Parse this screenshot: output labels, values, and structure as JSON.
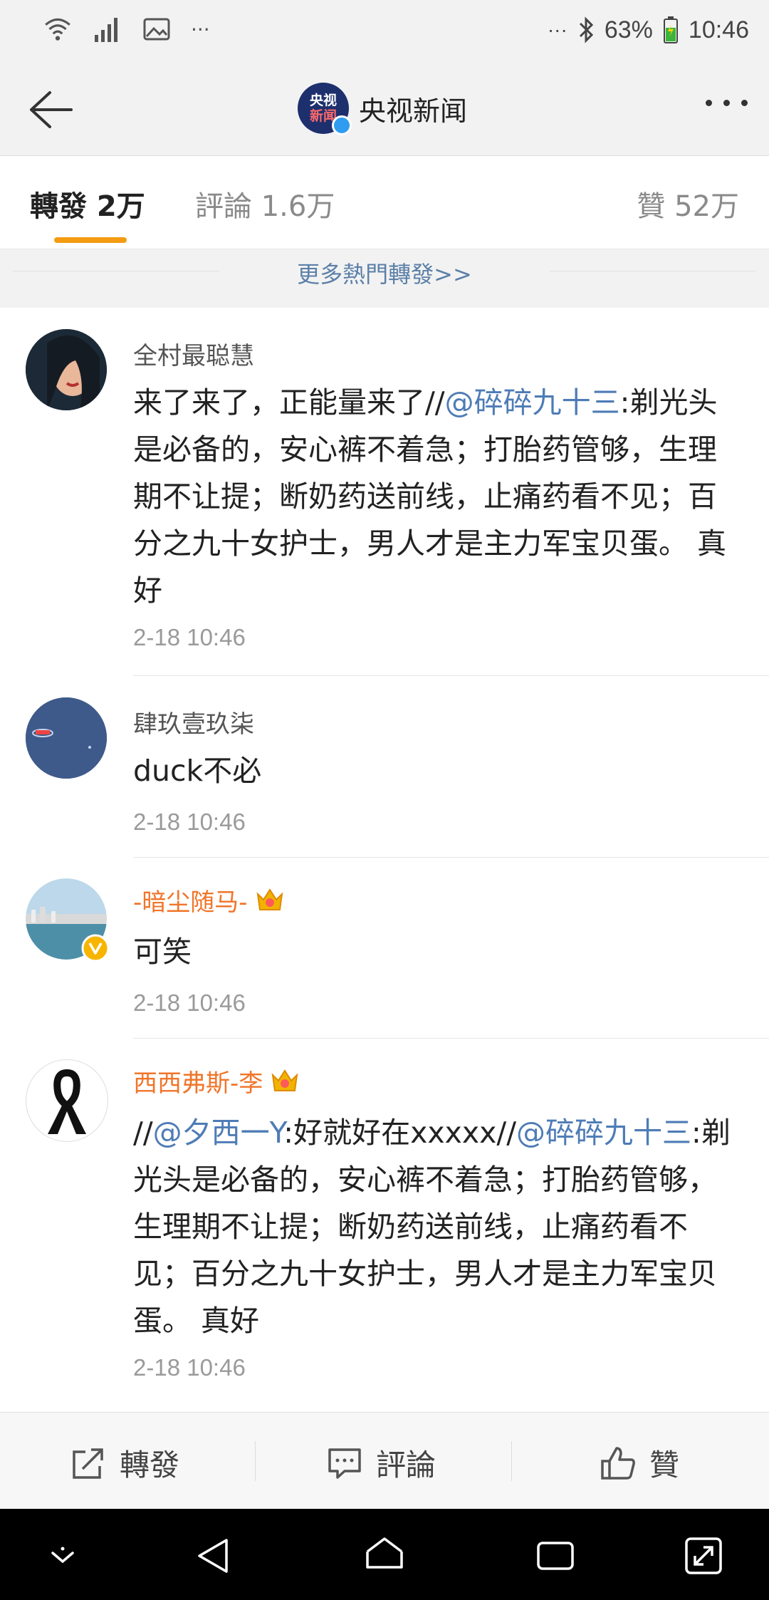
{
  "status_bar": {
    "dots_left": "···",
    "dots_right": "···",
    "battery": "63%",
    "time": "10:46"
  },
  "header": {
    "logo_line1": "央视",
    "logo_line2": "新闻",
    "title": "央视新闻"
  },
  "tabs": {
    "repost": "轉發 2万",
    "comment": "評論 1.6万",
    "like": "贊 52万"
  },
  "more_hot": "更多熱門轉發>>",
  "feed": [
    {
      "name": "全村最聪慧",
      "content_pre": "来了来了，正能量来了//",
      "mention": "@碎碎九十三",
      "content_post": ":剃光头是必备的，安心裤不着急；打胎药管够，生理期不让提；断奶药送前线，止痛药看不见；百分之九十女护士，男人才是主力军宝贝蛋。 真好",
      "time": "2-18 10:46"
    },
    {
      "name": "肆玖壹玖柒",
      "content": "duck不必",
      "time": "2-18 10:46"
    },
    {
      "name": "-暗尘随马-",
      "content": "可笑",
      "time": "2-18 10:46"
    },
    {
      "name": "西西弗斯-李",
      "content_pre": "//",
      "mention1": "@夕西一Y",
      "content_mid": ":好就好在xxxxx//",
      "mention2": "@碎碎九十三",
      "content_post": ":剃光头是必备的，安心裤不着急；打胎药管够，生理期不让提；断奶药送前线，止痛药看不见；百分之九十女护士，男人才是主力军宝贝蛋。 真好",
      "time": "2-18 10:46"
    }
  ],
  "actions": {
    "repost": "轉發",
    "comment": "評論",
    "like": "贊"
  },
  "colors": {
    "accent": "#f39c12",
    "link": "#4e7cb6",
    "vip_name": "#f0752a"
  }
}
